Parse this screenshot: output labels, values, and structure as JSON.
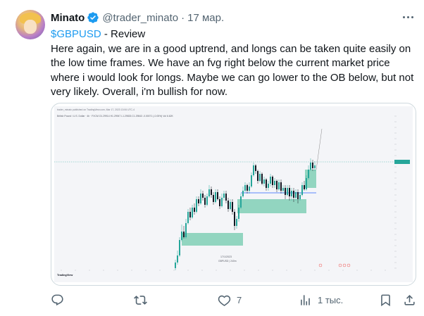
{
  "tweet": {
    "author_name": "Minato",
    "author_handle": "@trader_minato",
    "separator": "·",
    "date": "17 мар.",
    "cashtag": "$GBPUSD",
    "title_rest": " - Review",
    "body": "Here again, we are in a good uptrend, and longs can be taken quite easily on the low time frames. We have an fvg right below the current market price where i would look for longs. Maybe we can go lower to the OB below, but not very likely. Overall, i'm bullish for now."
  },
  "chart": {
    "header_text": "trader_minato published on TradingView.com, Mar 17, 2023 13:06 UTC-4",
    "sub_text": "British Pound / U.S. Dollar · 4h · FXCM  O1.29914  H1.29947  L1.29833  C1.29843  -0.00071 (-0.05%)  Vol  6.62K",
    "footer_logo": "TradingView",
    "annotation": "17/1/2023",
    "annotation_sub": "GBPUSD | 240m",
    "accent_green": "#26a69a",
    "accent_red": "#ef5350",
    "zone_color": "#80cfb6"
  },
  "actions": {
    "reply_count": "",
    "retweet_count": "",
    "like_count": "7",
    "views_count": "1 тыс.",
    "bookmark_count": ""
  },
  "colors": {
    "text_primary": "#0f1419",
    "text_secondary": "#536471",
    "link": "#1d9bf0",
    "verified": "#1d9bf0"
  }
}
